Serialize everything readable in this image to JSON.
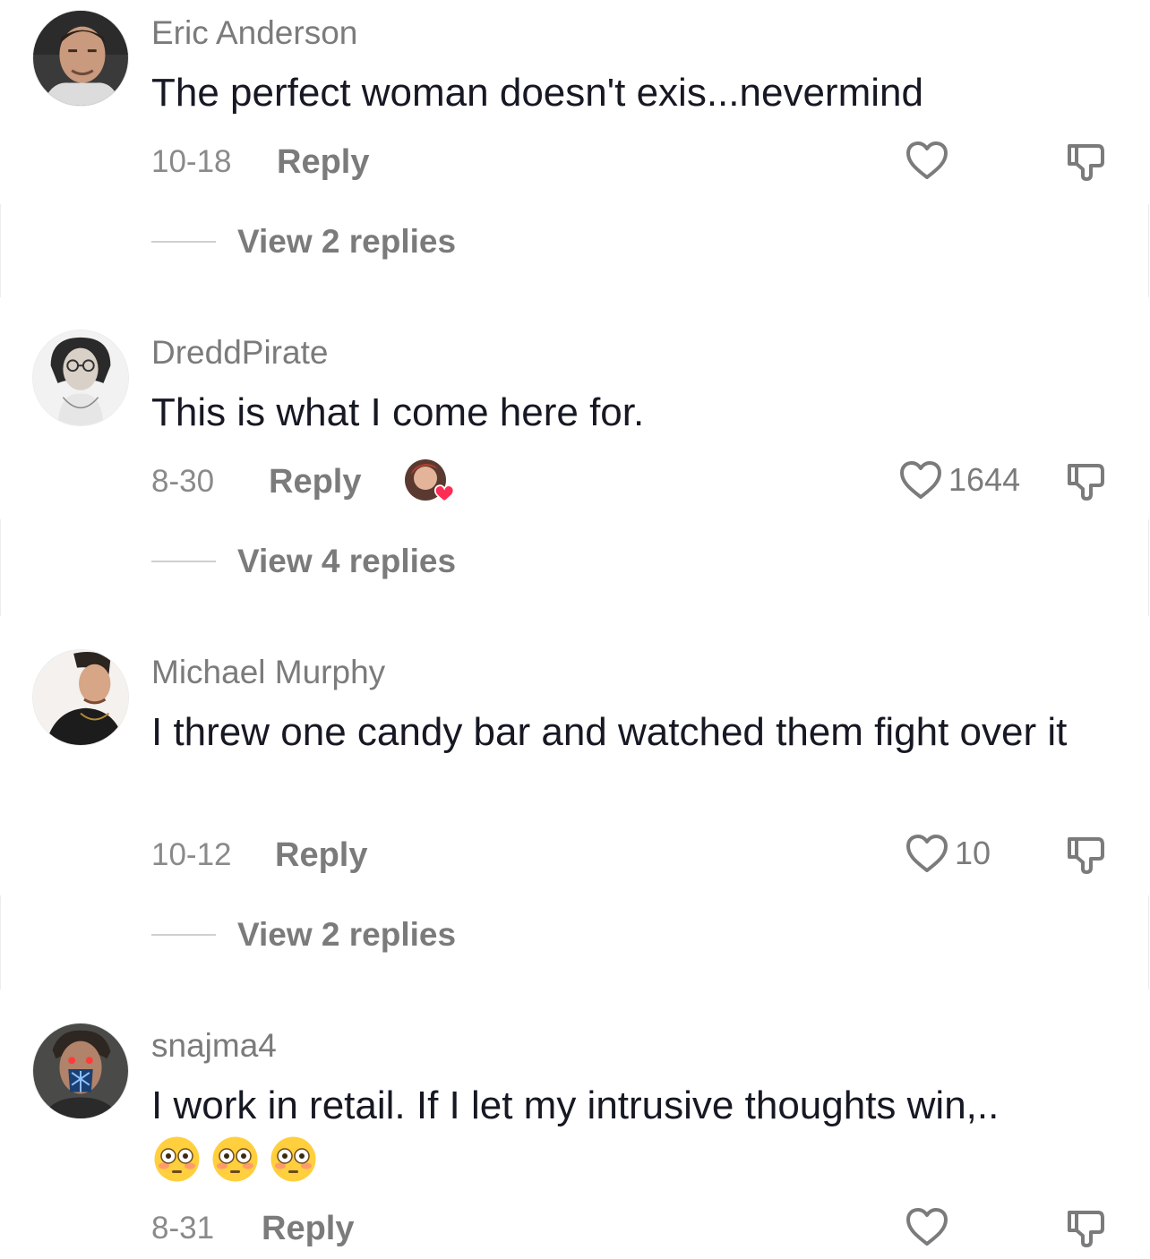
{
  "comments": [
    {
      "username": "Eric Anderson",
      "text": "The perfect woman doesn't exis...nevermind",
      "date": "10-18",
      "reply_label": "Reply",
      "like_count": "",
      "view_replies": "View 2 replies"
    },
    {
      "username": "DreddPirate",
      "text": "This is what I come here for.",
      "date": "8-30",
      "reply_label": "Reply",
      "like_count": "1644",
      "view_replies": "View 4 replies",
      "creator_liked": true
    },
    {
      "username": "Michael Murphy",
      "text": "I threw one candy bar and watched them fight over it",
      "date": "10-12",
      "reply_label": "Reply",
      "like_count": "10",
      "view_replies": "View 2 replies"
    },
    {
      "username": "snajma4",
      "text": "I work in retail. If I let my intrusive thoughts win,..",
      "emojis": [
        "flushed-face",
        "flushed-face",
        "flushed-face"
      ],
      "date": "8-31",
      "reply_label": "Reply",
      "like_count": ""
    }
  ],
  "colors": {
    "text_primary": "#161823",
    "text_secondary": "#7b7b7b",
    "creator_heart": "#fe2c55"
  }
}
